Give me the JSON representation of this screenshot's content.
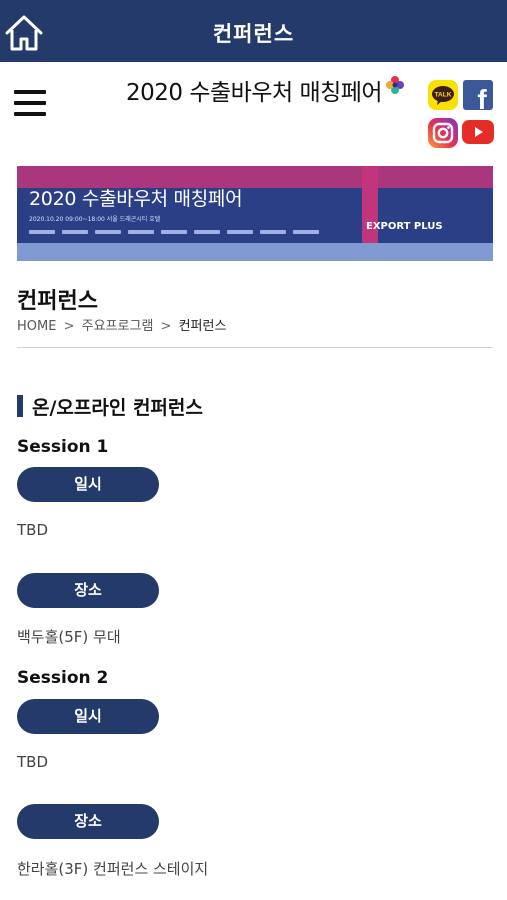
{
  "topbar": {
    "title": "컨퍼런스"
  },
  "header": {
    "logo_text": "2020 수출바우처 매칭페어",
    "sns": {
      "kakao_label": "TALK",
      "facebook_label": "f"
    }
  },
  "banner": {
    "title": "2020 수출바우처 매칭페어",
    "date_text": "2020.10.20   09:00~18:00          서울 드래곤시티 호텔",
    "badge": "EXPORT PLUS"
  },
  "page": {
    "title": "컨퍼런스",
    "breadcrumb": {
      "home": "HOME",
      "sep": ">",
      "parent": "주요프로그램",
      "current": "컨퍼런스"
    }
  },
  "section": {
    "title": "온/오프라인 컨퍼런스"
  },
  "sessions": [
    {
      "title": "Session 1",
      "date_label": "일시",
      "date_value": "TBD",
      "place_label": "장소",
      "place_value": "백두홀(5F) 무대"
    },
    {
      "title": "Session 2",
      "date_label": "일시",
      "date_value": "TBD",
      "place_label": "장소",
      "place_value": "한라홀(3F) 컨퍼런스 스테이지"
    }
  ],
  "colors": {
    "navy": "#233a6b",
    "banner": "#2a3f86",
    "accent_pink": "#c1357c"
  }
}
